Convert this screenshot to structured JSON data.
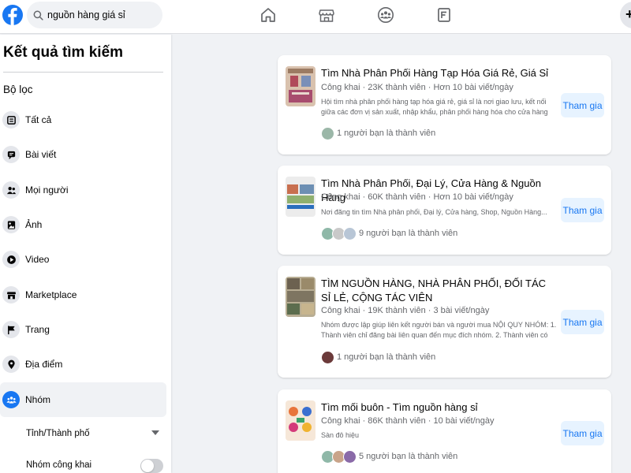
{
  "search": {
    "value": "nguồn hàng giá sỉ"
  },
  "colors": {
    "accent": "#1877f2",
    "join_bg": "#e7f3ff",
    "bg": "#f0f2f5"
  },
  "nav": [
    "home-icon",
    "marketplace-icon",
    "groups-icon",
    "gaming-icon"
  ],
  "sidebar": {
    "title": "Kết quả tìm kiếm",
    "filter_label": "Bộ lọc",
    "items": [
      {
        "label": "Tất cả",
        "icon": "all-icon"
      },
      {
        "label": "Bài viết",
        "icon": "posts-icon"
      },
      {
        "label": "Mọi người",
        "icon": "people-icon"
      },
      {
        "label": "Ảnh",
        "icon": "photos-icon"
      },
      {
        "label": "Video",
        "icon": "video-icon"
      },
      {
        "label": "Marketplace",
        "icon": "marketplace-icon"
      },
      {
        "label": "Trang",
        "icon": "pages-icon"
      },
      {
        "label": "Địa điểm",
        "icon": "places-icon"
      },
      {
        "label": "Nhóm",
        "icon": "groups-icon",
        "active": true
      }
    ],
    "sub_filters": [
      {
        "label": "Tỉnh/Thành phố"
      },
      {
        "label": "Nhóm công khai"
      }
    ]
  },
  "results": [
    {
      "title": "Tìm Nhà Phân Phối Hàng Tạp Hóa Giá Rẻ, Giá Sỉ",
      "meta": "Công khai · 23K thành viên · Hơn 10 bài viết/ngày",
      "desc": "Hội tìm nhà phân phối hàng tạp hóa giá rẻ, giá sỉ là nơi giao lưu, kết nối giữa các đơn vị sản xuất, nhập khẩu, phân phối hàng hóa cho cửa hàng tạp hóa, siêu t...",
      "friends": "1 người bạn là thành viên",
      "join": "Tham gia"
    },
    {
      "title": "Tìm Nhà Phân Phối, Đại Lý, Cửa Hàng & Nguồn Hàng",
      "meta": "Công khai · 60K thành viên · Hơn 10 bài viết/ngày",
      "desc": "Nơi đăng tin tìm Nhà phân phối, Đại lý, Cửa hàng, Shop, Nguồn Hàng...",
      "friends": "9 người bạn là thành viên",
      "join": "Tham gia"
    },
    {
      "title": "TÌM NGUỒN HÀNG, NHÀ PHÂN PHỐI, ĐỐI TÁC SỈ LẺ, CỘNG TÁC VIÊN",
      "meta": "Công khai · 19K thành viên · 3 bài viết/ngày",
      "desc": "Nhóm được lập giúp liên kết người bán và người mua NỘI QUY NHÓM: 1. Thành viên chỉ đăng bài liên quan đến mục đích nhóm. 2. Thành viên có những động th...",
      "friends": "1 người bạn là thành viên",
      "join": "Tham gia"
    },
    {
      "title": "Tìm mối buôn - Tìm nguồn hàng sỉ",
      "meta": "Công khai · 86K thành viên · 10 bài viết/ngày",
      "desc": "Sàn đô hiệu",
      "friends": "5 người bạn là thành viên",
      "join": "Tham gia"
    }
  ]
}
